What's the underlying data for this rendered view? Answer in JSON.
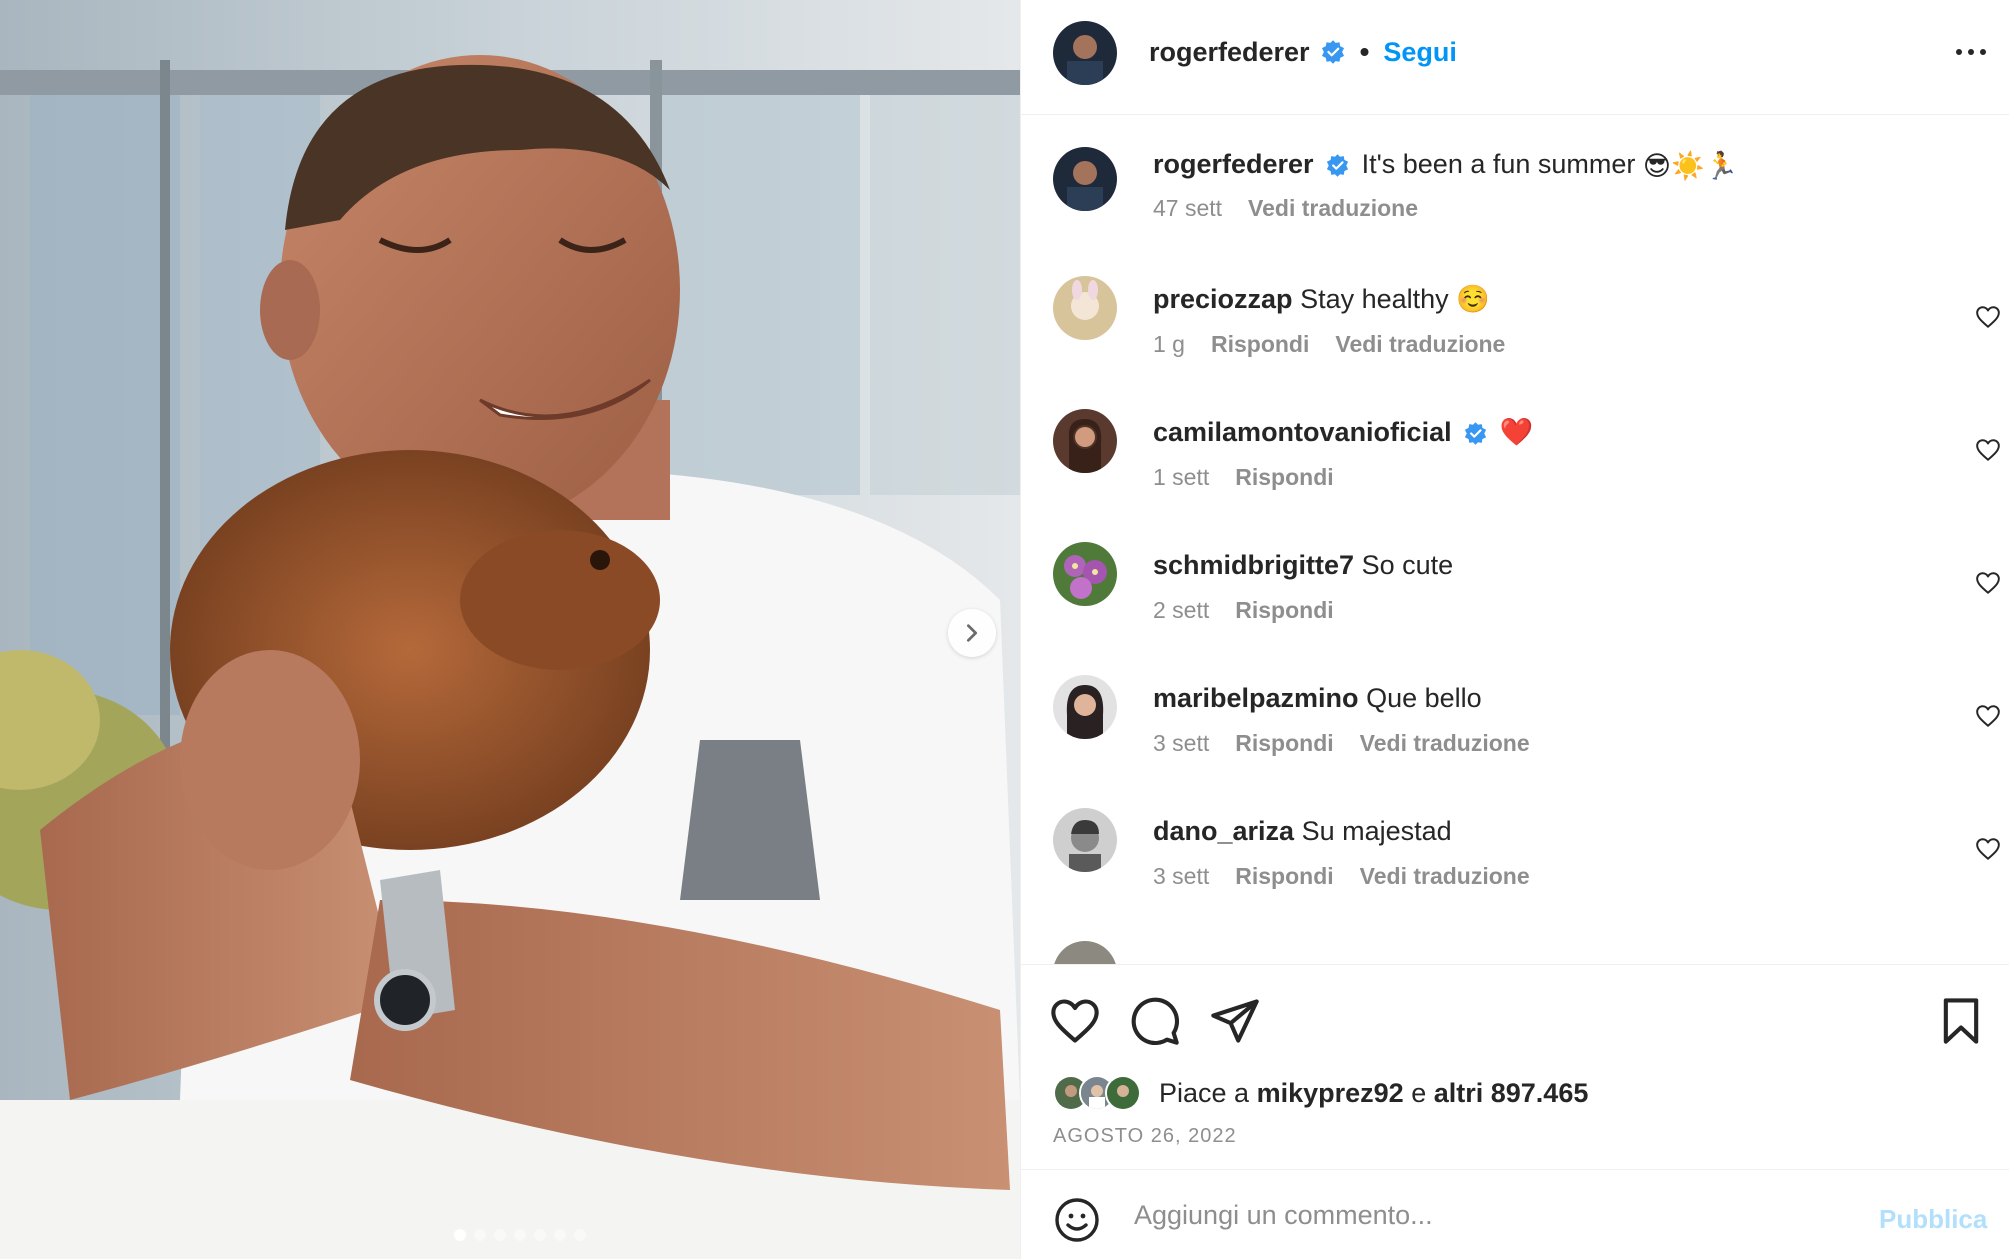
{
  "post": {
    "carousel": {
      "count": 7,
      "active_index": 0
    },
    "header": {
      "username": "rogerfederer",
      "separator": "•",
      "follow_label": "Segui"
    },
    "caption": {
      "username": "rogerfederer",
      "text": "It's been a fun summer",
      "emojis": "😎☀️🏃",
      "age": "47 sett",
      "translate_label": "Vedi traduzione"
    },
    "comments": [
      {
        "username": "preciozzap",
        "text": "Stay healthy ☺️",
        "age": "1 g",
        "reply_label": "Rispondi",
        "translate_label": "Vedi traduzione",
        "verified": false
      },
      {
        "username": "camilamontovanioficial",
        "text": "❤️",
        "age": "1 sett",
        "reply_label": "Rispondi",
        "translate_label": "",
        "verified": true
      },
      {
        "username": "schmidbrigitte7",
        "text": "So cute",
        "age": "2 sett",
        "reply_label": "Rispondi",
        "translate_label": "",
        "verified": false
      },
      {
        "username": "maribelpazmino",
        "text": "Que bello",
        "age": "3 sett",
        "reply_label": "Rispondi",
        "translate_label": "Vedi traduzione",
        "verified": false
      },
      {
        "username": "dano_ariza",
        "text": "Su majestad",
        "age": "3 sett",
        "reply_label": "Rispondi",
        "translate_label": "Vedi traduzione",
        "verified": false
      }
    ],
    "likes": {
      "prefix": "Piace a",
      "first_user": "mikyprez92",
      "connector": "e",
      "rest": "altri 897.465"
    },
    "date": "AGOSTO 26, 2022",
    "add_comment": {
      "placeholder": "Aggiungi un commento...",
      "publish_label": "Pubblica"
    },
    "icons": {
      "like": "heart-icon",
      "comment": "comment-icon",
      "share": "share-icon",
      "save": "bookmark-icon",
      "emoji": "smile-icon",
      "more": "more-icon",
      "next": "chevron-right-icon",
      "verified": "verified-badge-icon"
    },
    "colors": {
      "accent": "#0095f6",
      "verified": "#3897f0",
      "secondary_text": "#8e8e8e",
      "publish_disabled": "#b2dffc"
    }
  }
}
